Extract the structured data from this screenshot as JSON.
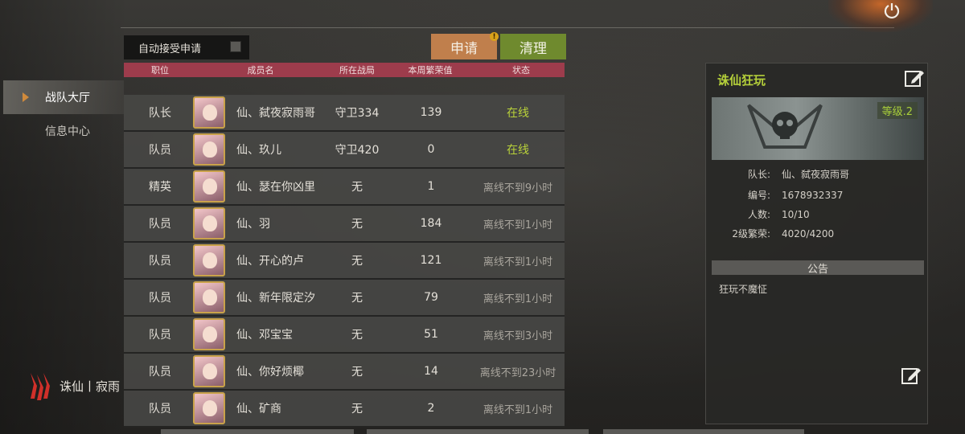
{
  "colors": {
    "accent_orange": "#c07f4c",
    "accent_green": "#6f8a2e",
    "header_red": "#9d3c4c",
    "online_green": "#b9d23a"
  },
  "toolbar": {
    "auto_accept_label": "自动接受申请",
    "apply_label": "申请",
    "apply_badge": "!",
    "clean_label": "清理"
  },
  "nav": {
    "items": [
      {
        "label": "战队大厅",
        "active": true
      },
      {
        "label": "信息中心",
        "active": false
      }
    ]
  },
  "brand": {
    "name": "诛仙丨寂雨",
    "logo_icon": "red-magic-logo-icon"
  },
  "table": {
    "headers": [
      "职位",
      "成员名",
      "所在战局",
      "本周繁荣值",
      "状态"
    ],
    "rows": [
      {
        "role": "队长",
        "name": "仙、弑夜寂雨哥",
        "zone": "守卫334",
        "prosperity": "139",
        "status": "在线",
        "online": true
      },
      {
        "role": "队员",
        "name": "仙、玖儿",
        "zone": "守卫420",
        "prosperity": "0",
        "status": "在线",
        "online": true
      },
      {
        "role": "精英",
        "name": "仙、瑟在你凶里",
        "zone": "无",
        "prosperity": "1",
        "status": "离线不到9小时",
        "online": false
      },
      {
        "role": "队员",
        "name": "仙、羽",
        "zone": "无",
        "prosperity": "184",
        "status": "离线不到1小时",
        "online": false
      },
      {
        "role": "队员",
        "name": "仙、开心的卢",
        "zone": "无",
        "prosperity": "121",
        "status": "离线不到1小时",
        "online": false
      },
      {
        "role": "队员",
        "name": "仙、新年限定汐",
        "zone": "无",
        "prosperity": "79",
        "status": "离线不到1小时",
        "online": false
      },
      {
        "role": "队员",
        "name": "仙、邓宝宝",
        "zone": "无",
        "prosperity": "51",
        "status": "离线不到3小时",
        "online": false
      },
      {
        "role": "队员",
        "name": "仙、你好烦椰",
        "zone": "无",
        "prosperity": "14",
        "status": "离线不到23小时",
        "online": false
      },
      {
        "role": "队员",
        "name": "仙、矿商",
        "zone": "无",
        "prosperity": "2",
        "status": "离线不到1小时",
        "online": false
      }
    ]
  },
  "team": {
    "name": "诛仙狂玩",
    "level": "等级.2",
    "info": [
      {
        "key": "队长:",
        "value": "仙、弑夜寂雨哥"
      },
      {
        "key": "编号:",
        "value": "1678932337"
      },
      {
        "key": "人数:",
        "value": "10/10"
      },
      {
        "key": "2级繁荣:",
        "value": "4020/4200"
      }
    ],
    "notice_title": "公告",
    "notice_text": "狂玩不魔怔"
  }
}
